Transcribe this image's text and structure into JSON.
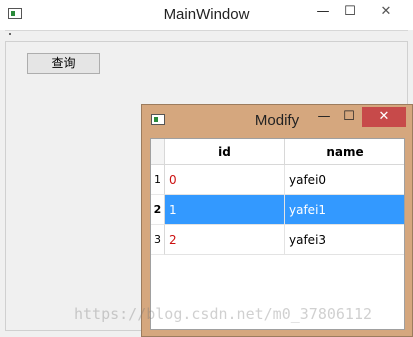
{
  "main_window": {
    "title": "MainWindow",
    "controls": {
      "minimize": "—",
      "maximize": "☐",
      "close": "✕"
    },
    "query_button": "查询"
  },
  "dialog": {
    "title": "Modify",
    "controls": {
      "minimize": "—",
      "maximize": "☐",
      "close": "✕"
    },
    "table": {
      "headers": [
        "id",
        "name"
      ],
      "rows": [
        {
          "num": "1",
          "id": "0",
          "name": "yafei0"
        },
        {
          "num": "2",
          "id": "1",
          "name": "yafei1"
        },
        {
          "num": "3",
          "id": "2",
          "name": "yafei3"
        }
      ],
      "selected_row": 2
    }
  },
  "watermark": "https://blog.csdn.net/m0_37806112",
  "colors": {
    "dialog_frame": "#d5a77e",
    "close_button": "#c74a4a",
    "selection": "#3399ff",
    "id_text": "#cc1111"
  }
}
